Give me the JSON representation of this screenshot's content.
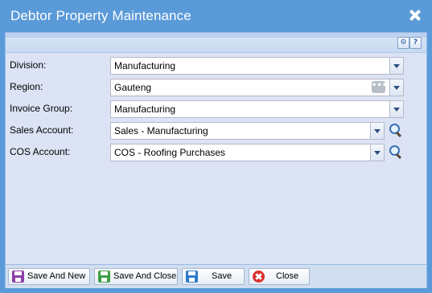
{
  "window": {
    "title": "Debtor Property Maintenance"
  },
  "toolbar": {
    "gear_icon": "gear-icon",
    "help_label": "?"
  },
  "form": {
    "division": {
      "label": "Division:",
      "value": "Manufacturing"
    },
    "region": {
      "label": "Region:",
      "value": "Gauteng",
      "ellipsis": "•••"
    },
    "invoice_group": {
      "label": "Invoice Group:",
      "value": "Manufacturing"
    },
    "sales_account": {
      "label": "Sales Account:",
      "value": "Sales - Manufacturing"
    },
    "cos_account": {
      "label": "COS Account:",
      "value": "COS - Roofing Purchases"
    }
  },
  "footer": {
    "save_and_new": "Save And New",
    "save_and_close": "Save And Close",
    "save": "Save",
    "close": "Close"
  },
  "colors": {
    "titlebar": "#5a9ad8",
    "body": "#dbe3f4",
    "save_and_new_icon": "#8e3fa8",
    "save_and_close_icon": "#3f9e45",
    "save_icon": "#2f7bc9",
    "close_icon": "#d8322c"
  }
}
